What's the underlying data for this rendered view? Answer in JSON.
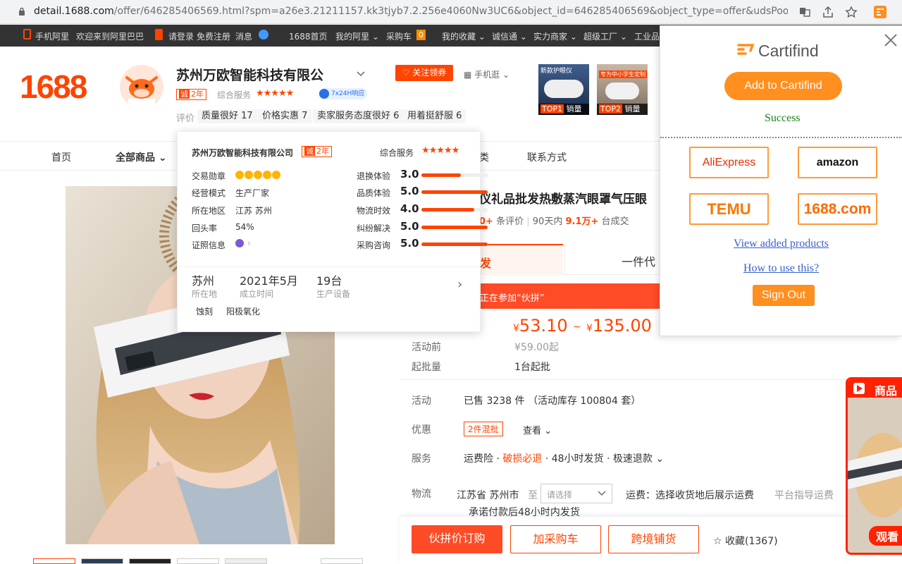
{
  "browser": {
    "url_host": "detail.1688.com",
    "url_path": "/offer/646285406569.html?spm=a26e3.21211157.kk3tjyb7.2.256e4060Nw3UC6&object_id=646285406569&object_type=offer&udsPoolId..."
  },
  "topbar": {
    "mobile": "手机阿里",
    "welcome": "欢迎来到阿里巴巴",
    "login": "请登录",
    "register": "免费注册",
    "messages": "消息",
    "home": "1688首页",
    "my_ali": "我的阿里",
    "cart": "采购车",
    "cart_count": "0",
    "favorites": "我的收藏",
    "chengxin": "诚信通",
    "power_merchant": "实力商家",
    "super_factory": "超级工厂",
    "industrial": "工业品"
  },
  "header": {
    "logo": "1688",
    "shop_name": "苏州万欧智能科技有限公",
    "years_tag": "诚",
    "years": "2年",
    "service_label": "综合服务",
    "stars": "★★★★★",
    "response": "7x24H响应",
    "follow": "关注领券",
    "mobile_browse": "手机逛",
    "eval_label": "评价",
    "eval_items": [
      "质量很好 17",
      "价格实惠 7",
      "卖家服务态度很好 6",
      "用着挺舒服 6"
    ],
    "ad1_title": "新款护眼仪",
    "ad1_rank": "TOP1",
    "ad1_sales": "销量",
    "ad2_title": "专为中小学生定制",
    "ad2_rank": "TOP2",
    "ad2_sales": "销量"
  },
  "nav": {
    "home": "首页",
    "all_products": "全部商品",
    "partial": "类",
    "contact": "联系方式"
  },
  "popup": {
    "company": "苏州万欧智能科技有限公司",
    "years_tag": "诚",
    "years": "2年",
    "service_label": "综合服务",
    "stars": "★★★★★",
    "rows_left": [
      {
        "label": "交易勋章",
        "value": ""
      },
      {
        "label": "经营模式",
        "value": "生产厂家"
      },
      {
        "label": "所在地区",
        "value": "江苏 苏州"
      },
      {
        "label": "回头率",
        "value": "54%"
      },
      {
        "label": "证照信息",
        "value": ""
      }
    ],
    "rows_right": [
      {
        "label": "退换体验",
        "score": "3.0",
        "fill": 0.6
      },
      {
        "label": "品质体验",
        "score": "5.0",
        "fill": 1.0
      },
      {
        "label": "物流时效",
        "score": "4.0",
        "fill": 0.8
      },
      {
        "label": "纠纷解决",
        "score": "5.0",
        "fill": 1.0
      },
      {
        "label": "采购咨询",
        "score": "5.0",
        "fill": 1.0
      }
    ],
    "location": "苏州",
    "location_label": "所在地",
    "founded": "2021年5月",
    "founded_label": "成立时间",
    "equipment": "19台",
    "equipment_label": "生产设备",
    "tags": [
      "蚀刻",
      "阳极氧化"
    ]
  },
  "product": {
    "title": "仪礼品批发热敷蒸汽眼罩气压眼",
    "reviews_num": "0+",
    "reviews_label": "条评价",
    "sold_label": "90天内",
    "sold_num": "9.1万+",
    "sold_unit": "台成交",
    "tab1": "发",
    "tab2": "一件代",
    "promo": "正在参加“伙拼”",
    "price_symbol": "¥",
    "price_low": "53.10",
    "price_sep": "~",
    "price_high": "135.00",
    "before_label": "活动前",
    "before_value": "¥59.00起",
    "moq_label": "起批量",
    "moq_value": "1台起批",
    "activity_label": "活动",
    "activity_value": "已售 3238 件 （活动库存 100804 套）",
    "discount_label": "优惠",
    "discount_tag": "2件混批",
    "discount_view": "查看",
    "service_label": "服务",
    "service_1": "运费险",
    "service_2": "破损必退",
    "service_3": "48小时发货",
    "service_4": "极速退款",
    "logistics_label": "物流",
    "logistics_from": "江苏省 苏州市",
    "logistics_to": "至",
    "logistics_select": "请选择",
    "freight": "运费：选择收货地后展示运费",
    "platform_guide": "平台指导运费",
    "promise": "承诺付款后48小时内发货"
  },
  "bottom": {
    "buy": "伙拼价订购",
    "add_cart": "加采购车",
    "cross_border": "跨境铺货",
    "favorite": "收藏(1367)"
  },
  "cartifind": {
    "brand": "Cartifind",
    "add_btn": "Add to Cartifind",
    "success": "Success",
    "markets": [
      "AliExpress",
      "amazon",
      "TEMU",
      "1688.com"
    ],
    "view_added": "View added products",
    "how_to": "How to use this?",
    "sign_out": "Sign Out"
  },
  "float_widget": {
    "title": "商品",
    "watch": "观看"
  },
  "colors": {
    "accent": "#ff4400",
    "cartifind": "#ff8f1f"
  }
}
